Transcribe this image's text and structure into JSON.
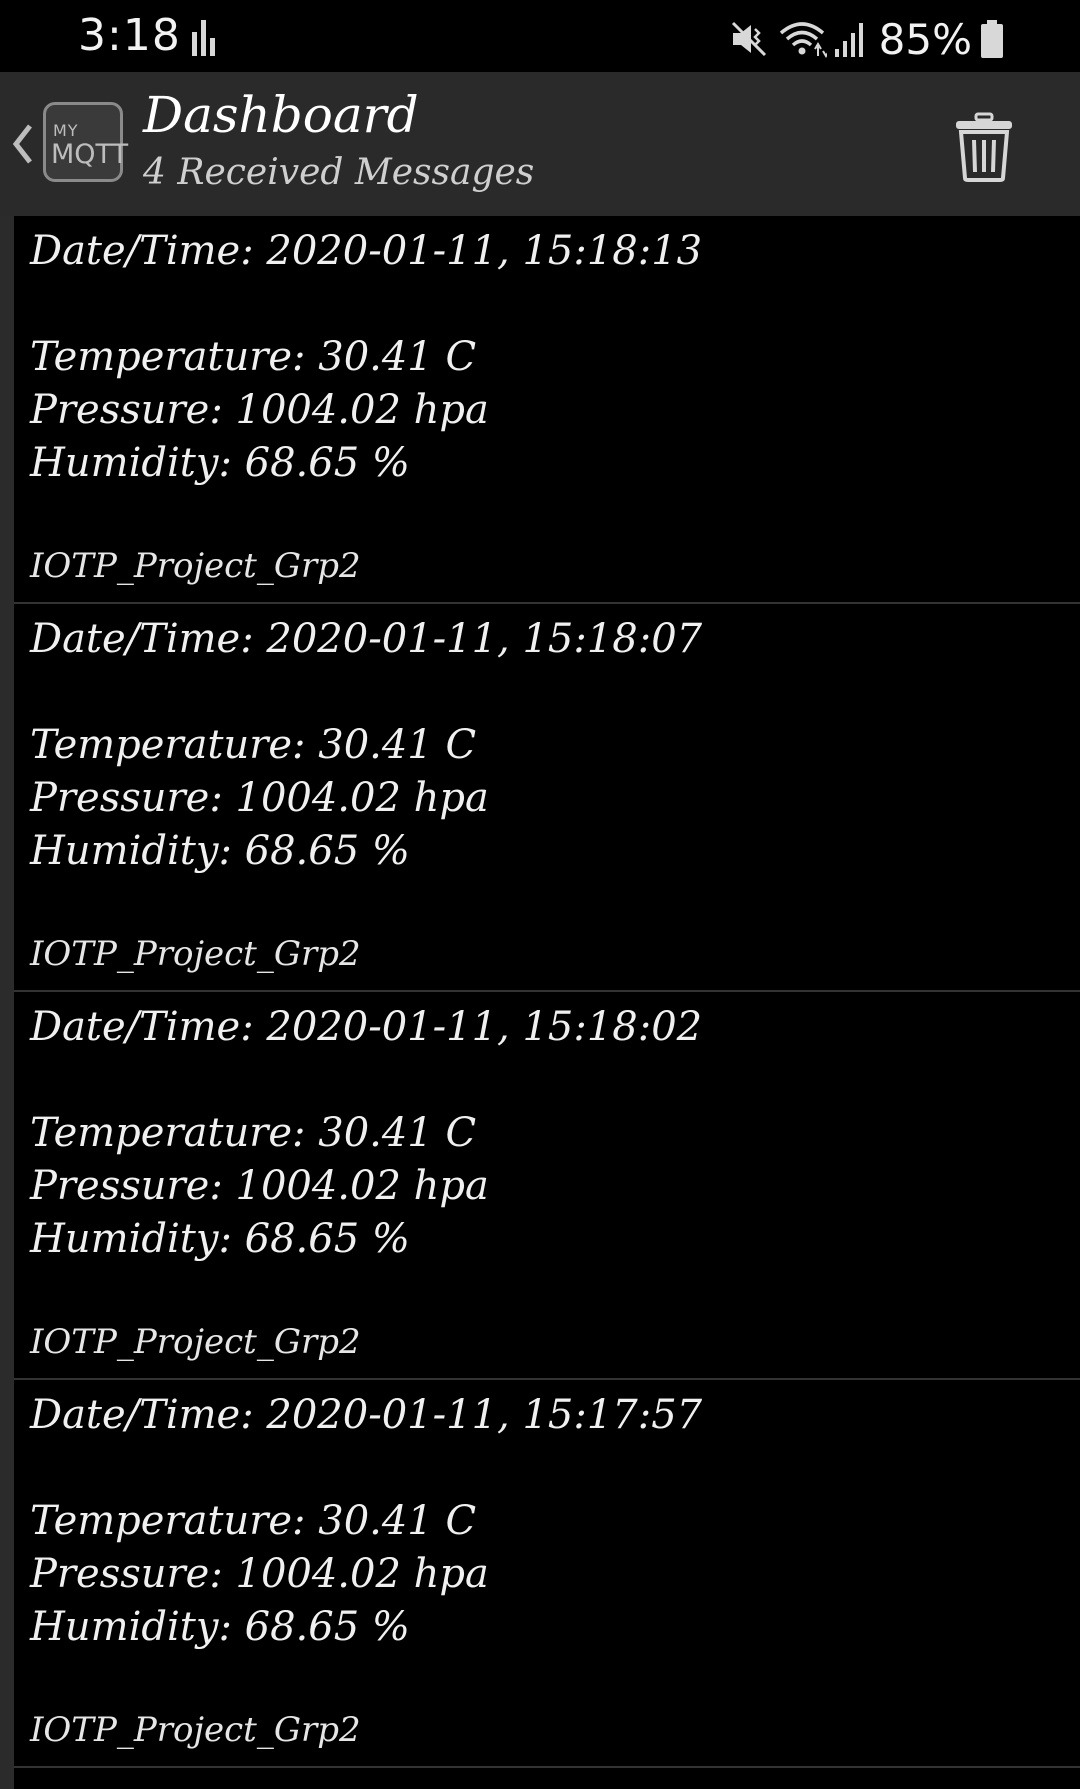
{
  "status_bar": {
    "time": "3:18",
    "battery_text": "85%",
    "icons": [
      "activity-chart-icon",
      "mute-vibrate-icon",
      "wifi-icon",
      "signal-icon",
      "battery-icon"
    ]
  },
  "app_bar": {
    "back_icon": "chevron-left-icon",
    "logo": {
      "top_text": "MY",
      "bottom_text": "MQTT"
    },
    "title": "Dashboard",
    "subtitle": "4 Received Messages",
    "action_icon": "trash-icon"
  },
  "messages": [
    {
      "datetime": "Date/Time: 2020-01-11, 15:18:13",
      "temperature": "Temperature: 30.41 C",
      "pressure": "Pressure: 1004.02 hpa",
      "humidity": "Humidity: 68.65 %",
      "topic": "IOTP_Project_Grp2"
    },
    {
      "datetime": "Date/Time: 2020-01-11, 15:18:07",
      "temperature": "Temperature: 30.41 C",
      "pressure": "Pressure: 1004.02 hpa",
      "humidity": "Humidity: 68.65 %",
      "topic": "IOTP_Project_Grp2"
    },
    {
      "datetime": "Date/Time: 2020-01-11, 15:18:02",
      "temperature": "Temperature: 30.41 C",
      "pressure": "Pressure: 1004.02 hpa",
      "humidity": "Humidity: 68.65 %",
      "topic": "IOTP_Project_Grp2"
    },
    {
      "datetime": "Date/Time: 2020-01-11, 15:17:57",
      "temperature": "Temperature: 30.41 C",
      "pressure": "Pressure: 1004.02 hpa",
      "humidity": "Humidity: 68.65 %",
      "topic": "IOTP_Project_Grp2"
    }
  ],
  "colors": {
    "background": "#000000",
    "app_bar": "#2a2a2a",
    "text": "#f0f0f0",
    "divider": "#333333"
  }
}
